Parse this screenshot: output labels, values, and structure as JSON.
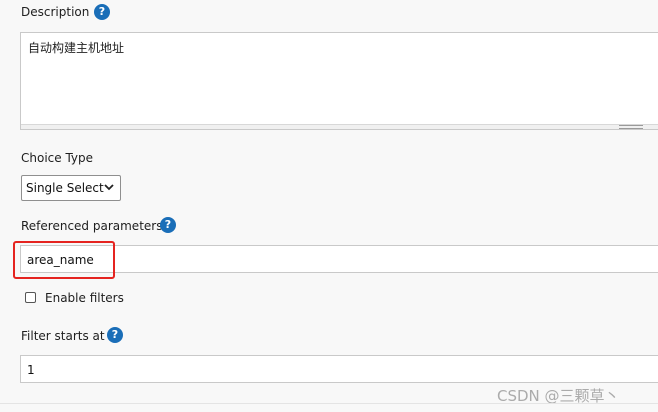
{
  "description": {
    "label": "Description",
    "help_icon": "?",
    "value": "自动构建主机地址"
  },
  "choice_type": {
    "label": "Choice Type",
    "selected": "Single Select"
  },
  "referenced_parameters": {
    "label": "Referenced parameters",
    "help_icon": "?",
    "value": "area_name",
    "highlight_color": "#e52420"
  },
  "enable_filters": {
    "label": "Enable filters",
    "checked": false
  },
  "filter_starts_at": {
    "label": "Filter starts at",
    "help_icon": "?",
    "value": "1"
  },
  "watermark": {
    "text": "CSDN @三颗草丶"
  },
  "colors": {
    "help_icon_bg": "#1a6eb8",
    "page_bg": "#f8f8f8"
  }
}
